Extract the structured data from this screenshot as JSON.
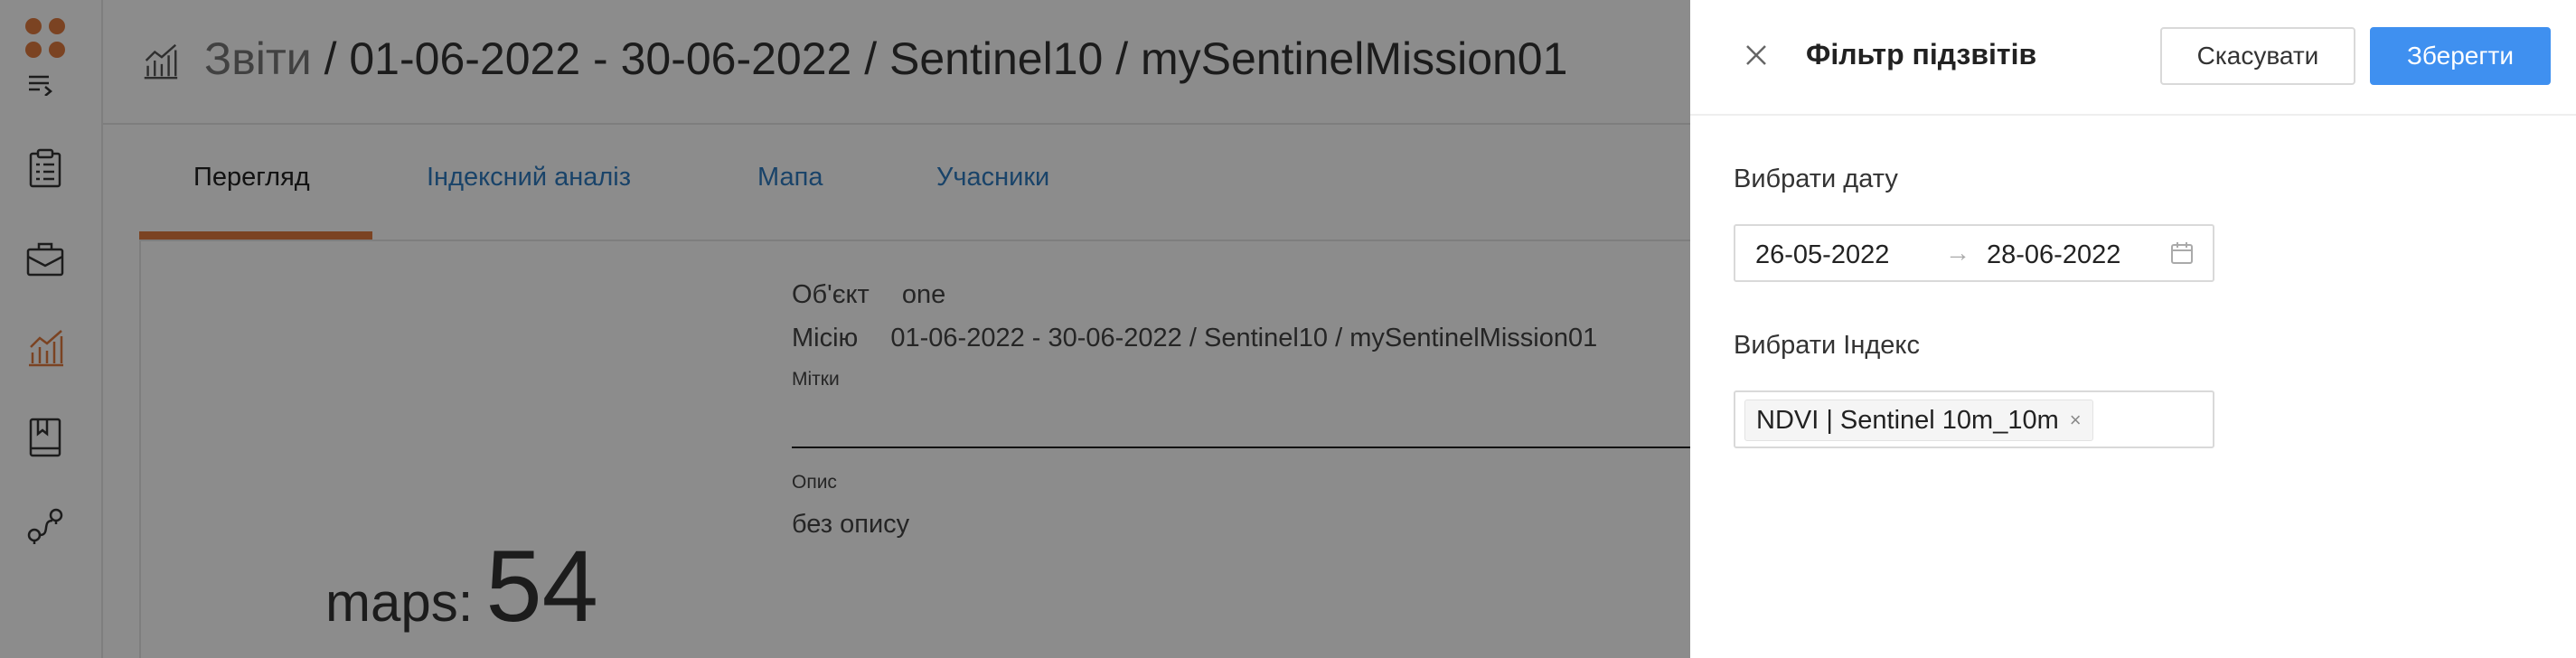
{
  "header": {
    "breadcrumb_root": "Звіти",
    "breadcrumb_rest": " / 01-06-2022 - 30-06-2022 / Sentinel10 / mySentinelMission01"
  },
  "tabs": [
    {
      "label": "Перегляд"
    },
    {
      "label": "Індексний аналіз"
    },
    {
      "label": "Мапа"
    },
    {
      "label": "Учасники"
    }
  ],
  "details": {
    "object_label": "Об'єкт",
    "object_value": "one",
    "mission_label": "Місію",
    "mission_value": "01-06-2022 - 30-06-2022 / Sentinel10 / mySentinelMission01",
    "tags_label": "Мітки",
    "description_label": "Опис",
    "description_value": "без опису"
  },
  "stats": {
    "maps_label": "maps:",
    "maps_count": "54"
  },
  "drawer": {
    "title": "Фільтр підзвітів",
    "cancel_label": "Скасувати",
    "save_label": "Зберегти",
    "date_label": "Вибрати дату",
    "date_start": "26-05-2022",
    "date_separator": "→",
    "date_end": "28-06-2022",
    "index_label": "Вибрати Індекс",
    "index_tag": "NDVI | Sentinel 10m_10m",
    "index_tag_remove": "×"
  },
  "colors": {
    "accent": "#e07a3f",
    "primary": "#3f90f0",
    "link": "#2f7bbf"
  },
  "icons": [
    "logo-icon",
    "menu-collapse-icon",
    "clipboard-icon",
    "briefcase-icon",
    "chart-icon",
    "book-icon",
    "route-icon",
    "close-icon",
    "calendar-icon"
  ]
}
